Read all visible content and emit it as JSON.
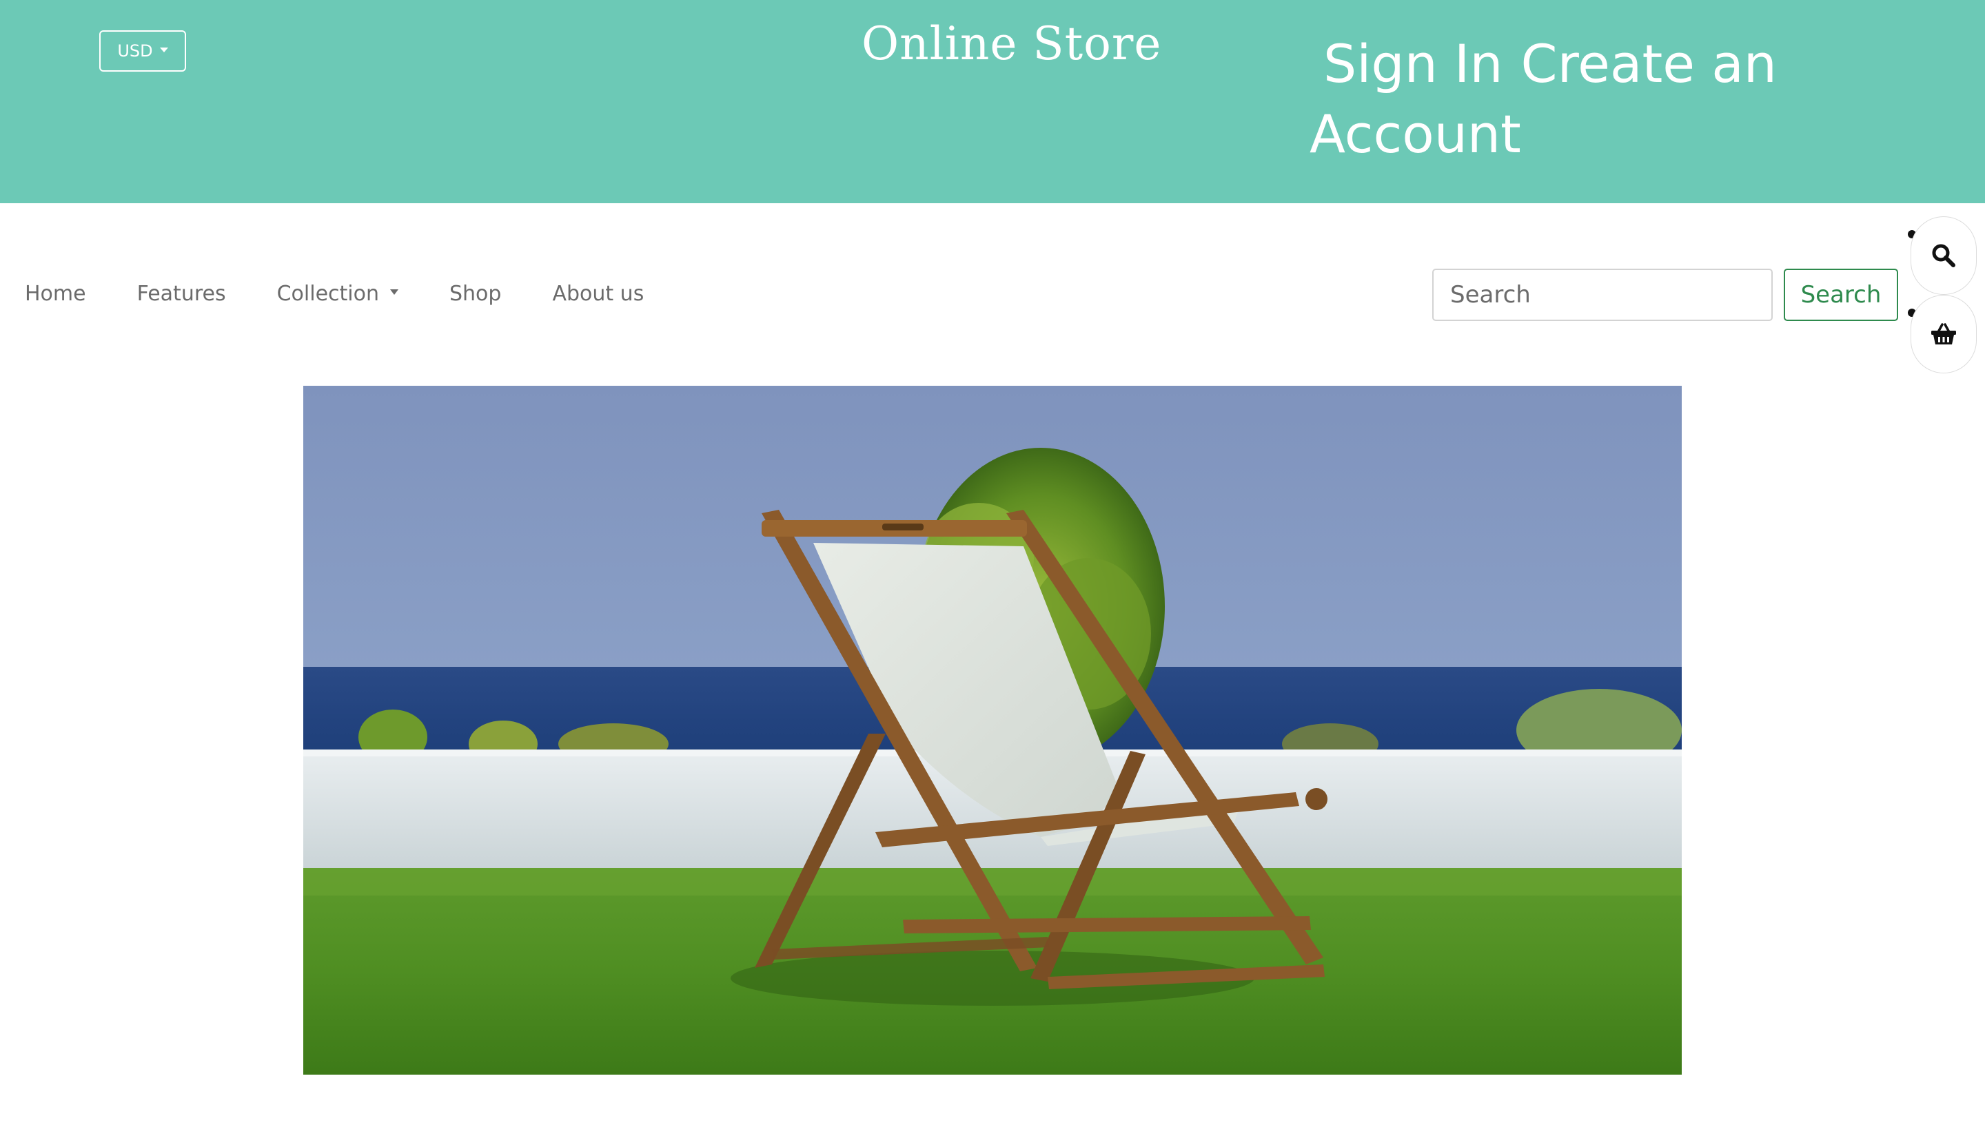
{
  "header": {
    "currency": "USD",
    "store_title": "Online Store",
    "sign_in": "Sign In",
    "create_account": "Create an Account"
  },
  "nav": {
    "items": [
      {
        "label": "Home"
      },
      {
        "label": "Features"
      },
      {
        "label": "Collection",
        "has_dropdown": true
      },
      {
        "label": "Shop"
      },
      {
        "label": "About us"
      }
    ]
  },
  "search": {
    "placeholder": "Search",
    "button_label": "Search"
  },
  "icons": [
    "search-icon",
    "basket-icon"
  ],
  "colors": {
    "header_bg": "#6cc9b6",
    "header_text": "#ffffff",
    "nav_text": "#6b6b6b",
    "search_button": "#2e8a4d"
  },
  "hero": {
    "image": "wooden-deck-chair-on-lawn-by-sea"
  }
}
